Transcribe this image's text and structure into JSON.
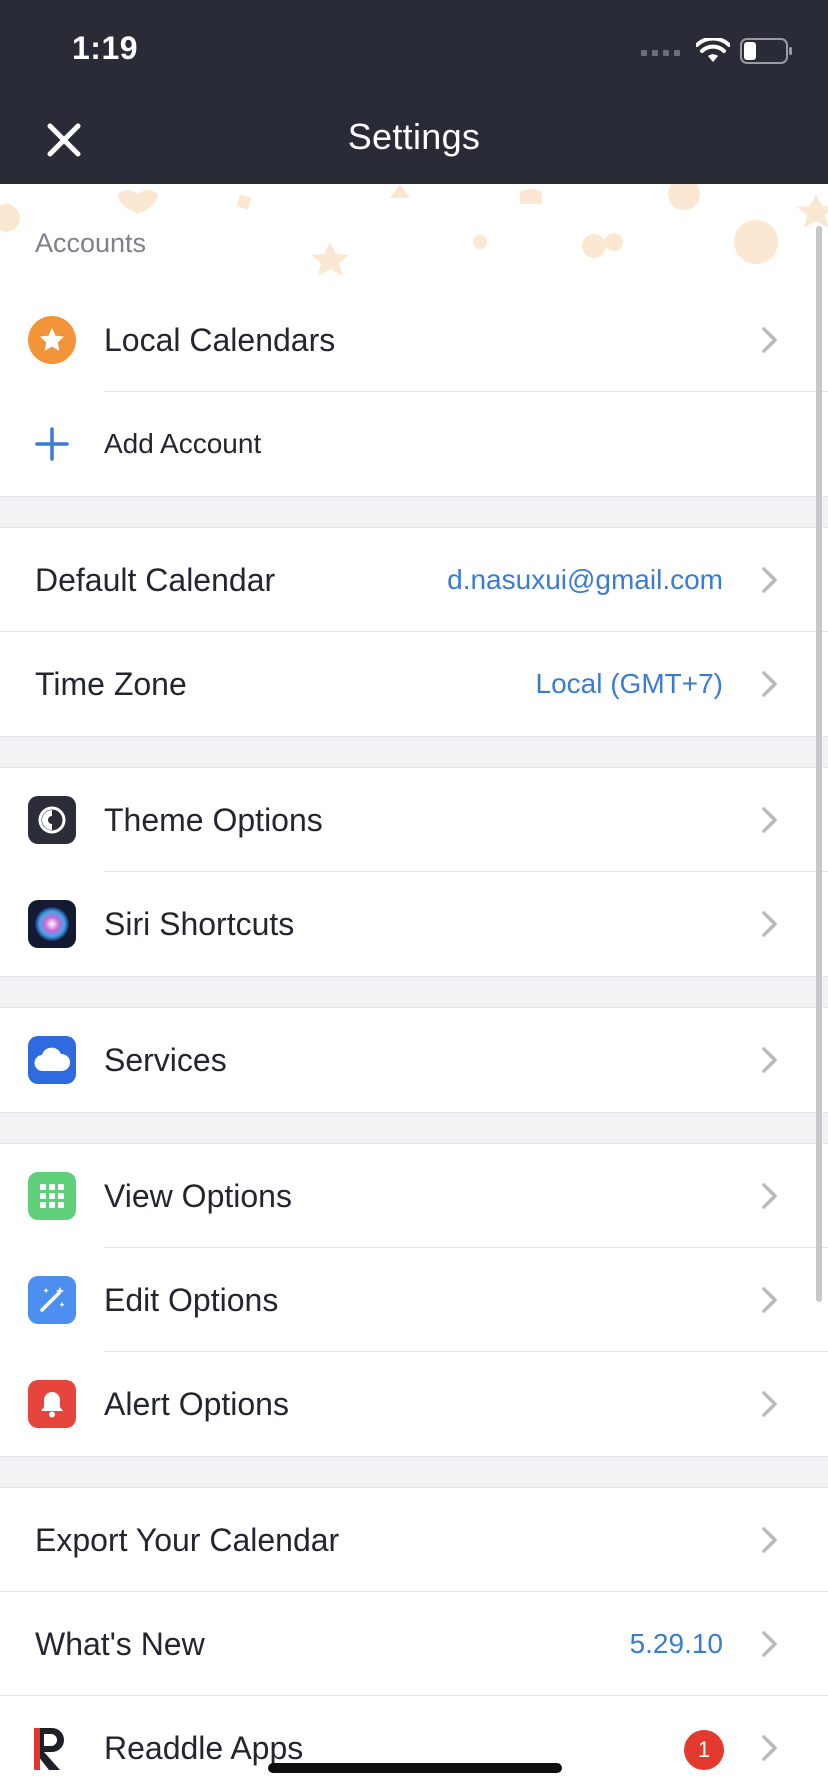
{
  "status_bar": {
    "time": "1:19"
  },
  "nav": {
    "title": "Settings",
    "close_icon": "close-icon"
  },
  "accounts": {
    "header": "Accounts",
    "local_calendars": "Local Calendars",
    "add_account": "Add Account"
  },
  "general": {
    "default_calendar": {
      "label": "Default Calendar",
      "value": "d.nasuxui@gmail.com"
    },
    "time_zone": {
      "label": "Time Zone",
      "value": "Local (GMT+7)"
    }
  },
  "appearance": {
    "theme_options": "Theme Options",
    "siri_shortcuts": "Siri Shortcuts"
  },
  "services": {
    "label": "Services"
  },
  "options": {
    "view_options": "View Options",
    "edit_options": "Edit Options",
    "alert_options": "Alert Options"
  },
  "more": {
    "export": "Export Your Calendar",
    "whats_new": {
      "label": "What's New",
      "value": "5.29.10"
    },
    "readdle_apps": {
      "label": "Readdle Apps",
      "badge": "1"
    }
  },
  "colors": {
    "header_bg": "#292b36",
    "accent_blue": "#3a7bd5",
    "orange": "#f29437",
    "badge_red": "#e23a2e"
  }
}
